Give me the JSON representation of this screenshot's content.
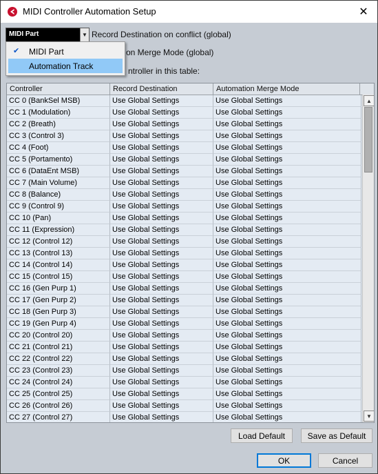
{
  "window": {
    "title": "MIDI Controller Automation Setup"
  },
  "icons": {
    "app": "cubase-app-icon",
    "close": "close-icon",
    "dropdown": "chevron-down-icon",
    "check": "check-icon"
  },
  "combo": {
    "value": "MIDI Part"
  },
  "labels": {
    "record_destination": "Record Destination on conflict (global)",
    "merge_mode_partial": "on Merge Mode (global)",
    "controller_table_partial": "ntroller in this table:"
  },
  "dropdown": {
    "items": [
      {
        "label": "MIDI Part",
        "checked": true
      },
      {
        "label": "Automation Track",
        "highlighted": true
      }
    ]
  },
  "table": {
    "headers": [
      "Controller",
      "Record Destination",
      "Automation Merge Mode"
    ],
    "rows": [
      [
        "CC 0  (BankSel MSB)",
        "Use Global Settings",
        "Use Global Settings"
      ],
      [
        "CC 1  (Modulation)",
        "Use Global Settings",
        "Use Global Settings"
      ],
      [
        "CC 2  (Breath)",
        "Use Global Settings",
        "Use Global Settings"
      ],
      [
        "CC 3  (Control 3)",
        "Use Global Settings",
        "Use Global Settings"
      ],
      [
        "CC 4  (Foot)",
        "Use Global Settings",
        "Use Global Settings"
      ],
      [
        "CC 5  (Portamento)",
        "Use Global Settings",
        "Use Global Settings"
      ],
      [
        "CC 6  (DataEnt MSB)",
        "Use Global Settings",
        "Use Global Settings"
      ],
      [
        "CC 7  (Main Volume)",
        "Use Global Settings",
        "Use Global Settings"
      ],
      [
        "CC 8  (Balance)",
        "Use Global Settings",
        "Use Global Settings"
      ],
      [
        "CC 9  (Control 9)",
        "Use Global Settings",
        "Use Global Settings"
      ],
      [
        "CC 10  (Pan)",
        "Use Global Settings",
        "Use Global Settings"
      ],
      [
        "CC 11  (Expression)",
        "Use Global Settings",
        "Use Global Settings"
      ],
      [
        "CC 12  (Control 12)",
        "Use Global Settings",
        "Use Global Settings"
      ],
      [
        "CC 13  (Control 13)",
        "Use Global Settings",
        "Use Global Settings"
      ],
      [
        "CC 14  (Control 14)",
        "Use Global Settings",
        "Use Global Settings"
      ],
      [
        "CC 15  (Control 15)",
        "Use Global Settings",
        "Use Global Settings"
      ],
      [
        "CC 16  (Gen Purp 1)",
        "Use Global Settings",
        "Use Global Settings"
      ],
      [
        "CC 17  (Gen Purp 2)",
        "Use Global Settings",
        "Use Global Settings"
      ],
      [
        "CC 18  (Gen Purp 3)",
        "Use Global Settings",
        "Use Global Settings"
      ],
      [
        "CC 19  (Gen Purp 4)",
        "Use Global Settings",
        "Use Global Settings"
      ],
      [
        "CC 20  (Control 20)",
        "Use Global Settings",
        "Use Global Settings"
      ],
      [
        "CC 21  (Control 21)",
        "Use Global Settings",
        "Use Global Settings"
      ],
      [
        "CC 22  (Control 22)",
        "Use Global Settings",
        "Use Global Settings"
      ],
      [
        "CC 23  (Control 23)",
        "Use Global Settings",
        "Use Global Settings"
      ],
      [
        "CC 24  (Control 24)",
        "Use Global Settings",
        "Use Global Settings"
      ],
      [
        "CC 25  (Control 25)",
        "Use Global Settings",
        "Use Global Settings"
      ],
      [
        "CC 26  (Control 26)",
        "Use Global Settings",
        "Use Global Settings"
      ],
      [
        "CC 27  (Control 27)",
        "Use Global Settings",
        "Use Global Settings"
      ]
    ]
  },
  "buttons": {
    "load_default": "Load Default",
    "save_as_default": "Save as Default",
    "ok": "OK",
    "cancel": "Cancel"
  },
  "colors": {
    "dialog_bg": "#c6ccd4",
    "table_bg": "#e4ebf3",
    "highlight": "#91c9f7",
    "accent": "#0078d7"
  }
}
